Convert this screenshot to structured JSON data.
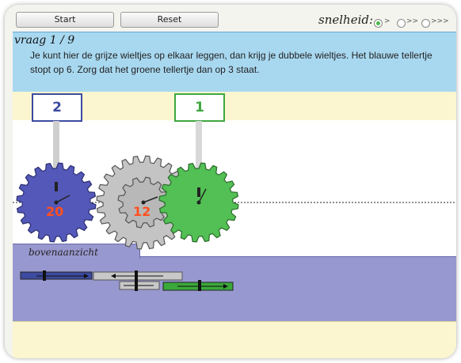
{
  "toolbar": {
    "start_label": "Start",
    "reset_label": "Reset"
  },
  "speed": {
    "label": "snelheid:",
    "options": [
      ">",
      ">>",
      ">>>"
    ],
    "selected_index": 0
  },
  "question": {
    "title": "vraag 1 / 9",
    "text": "Je kunt hier de grijze wieltjes op elkaar leggen, dan krijg je dubbele wieltjes. Het blauwe tellertje stopt op 6. Zorg dat het groene tellertje dan op 3 staat."
  },
  "counters": {
    "blue": "2",
    "green": "1"
  },
  "gears": {
    "blue_teeth": "20",
    "grey_teeth": "12"
  },
  "view_label": "bovenaanzicht",
  "colors": {
    "blue": "#5458b8",
    "grey": "#c4c4c4",
    "green": "#52c054",
    "counter_blue": "#3c4aa0",
    "counter_green": "#3fa83f"
  }
}
